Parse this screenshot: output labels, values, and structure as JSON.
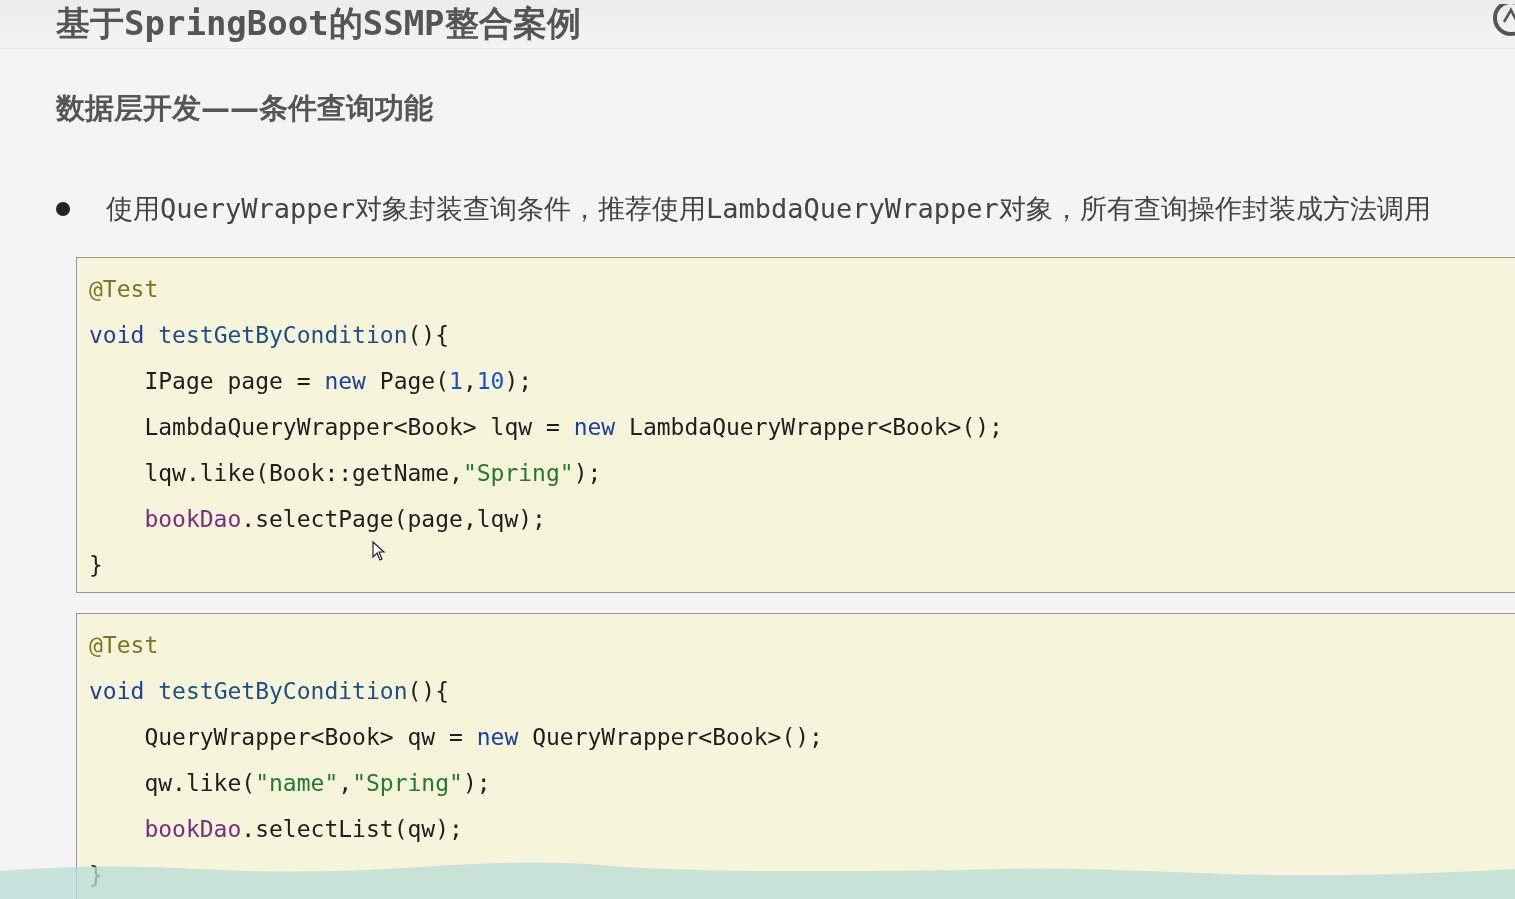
{
  "title": "基于SpringBoot的SSMP整合案例",
  "subtitle": "数据层开发——条件查询功能",
  "bullet": "使用QueryWrapper对象封装查询条件，推荐使用LambdaQueryWrapper对象，所有查询操作封装成方法调用",
  "code_blocks": [
    {
      "lines": [
        {
          "tokens": [
            {
              "kind": "annotation",
              "text": "@Test"
            }
          ]
        },
        {
          "tokens": [
            {
              "kind": "keyword",
              "text": "void"
            },
            {
              "kind": "method",
              "text": " testGetByCondition"
            },
            {
              "kind": "plain",
              "text": "(){"
            }
          ]
        },
        {
          "tokens": [
            {
              "kind": "plain",
              "text": "    IPage page = "
            },
            {
              "kind": "keyword",
              "text": "new"
            },
            {
              "kind": "plain",
              "text": " Page("
            },
            {
              "kind": "number",
              "text": "1"
            },
            {
              "kind": "plain",
              "text": ","
            },
            {
              "kind": "number",
              "text": "10"
            },
            {
              "kind": "plain",
              "text": ");"
            }
          ]
        },
        {
          "tokens": [
            {
              "kind": "plain",
              "text": "    LambdaQueryWrapper<Book> lqw = "
            },
            {
              "kind": "keyword",
              "text": "new"
            },
            {
              "kind": "plain",
              "text": " LambdaQueryWrapper<Book>();"
            }
          ]
        },
        {
          "tokens": [
            {
              "kind": "plain",
              "text": "    lqw.like(Book::getName,"
            },
            {
              "kind": "string",
              "text": "\"Spring\""
            },
            {
              "kind": "plain",
              "text": ");"
            }
          ]
        },
        {
          "tokens": [
            {
              "kind": "field",
              "text": "    bookDao"
            },
            {
              "kind": "plain",
              "text": ".selectPage(page,lqw);"
            }
          ]
        },
        {
          "tokens": [
            {
              "kind": "plain",
              "text": "}"
            }
          ]
        }
      ]
    },
    {
      "lines": [
        {
          "tokens": [
            {
              "kind": "annotation",
              "text": "@Test"
            }
          ]
        },
        {
          "tokens": [
            {
              "kind": "keyword",
              "text": "void"
            },
            {
              "kind": "method",
              "text": " testGetByCondition"
            },
            {
              "kind": "plain",
              "text": "(){"
            }
          ]
        },
        {
          "tokens": [
            {
              "kind": "plain",
              "text": "    QueryWrapper<Book> qw = "
            },
            {
              "kind": "keyword",
              "text": "new"
            },
            {
              "kind": "plain",
              "text": " QueryWrapper<Book>();"
            }
          ]
        },
        {
          "tokens": [
            {
              "kind": "plain",
              "text": "    qw.like("
            },
            {
              "kind": "string",
              "text": "\"name\""
            },
            {
              "kind": "plain",
              "text": ","
            },
            {
              "kind": "string",
              "text": "\"Spring\""
            },
            {
              "kind": "plain",
              "text": ");"
            }
          ]
        },
        {
          "tokens": [
            {
              "kind": "field",
              "text": "    bookDao"
            },
            {
              "kind": "plain",
              "text": ".selectList(qw);"
            }
          ]
        },
        {
          "tokens": [
            {
              "kind": "plain",
              "text": "}"
            }
          ]
        }
      ]
    }
  ]
}
